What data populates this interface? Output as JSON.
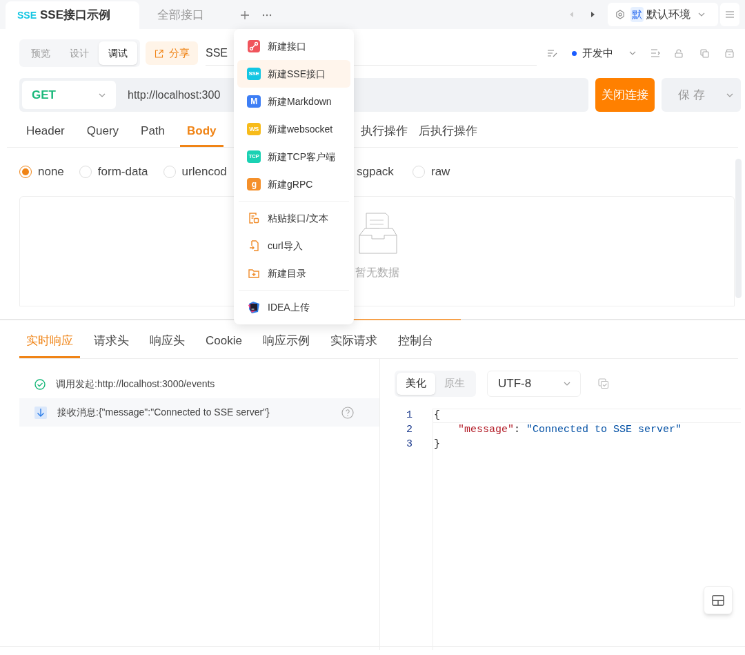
{
  "tabs": [
    {
      "badge": "SSE",
      "label": "SSE接口示例",
      "selected": true
    },
    {
      "label": "全部接口",
      "selected": false
    }
  ],
  "environment": {
    "badge": "默",
    "label": "默认环境"
  },
  "modes": [
    {
      "label": "预览",
      "selected": false
    },
    {
      "label": "设计",
      "selected": false
    },
    {
      "label": "调试",
      "selected": true
    }
  ],
  "share": "分享",
  "name": "SSE",
  "status": "开发中",
  "method": "GET",
  "url": "http://localhost:300",
  "actions": [
    "关闭连接",
    "保 存"
  ],
  "request_tabs": [
    {
      "label": "Header",
      "selected": false,
      "kind": "tab"
    },
    {
      "label": "Query",
      "selected": false,
      "kind": "tab"
    },
    {
      "label": "Path",
      "selected": false,
      "kind": "tab"
    },
    {
      "label": "Body",
      "selected": true,
      "kind": "tab"
    },
    {
      "label": "执行操作",
      "selected": false,
      "kind": "partial"
    },
    {
      "label": "后执行操作",
      "selected": false,
      "kind": "tab"
    }
  ],
  "body_types": [
    {
      "label": "none",
      "selected": true,
      "kind": "radio"
    },
    {
      "label": "form-data",
      "selected": false,
      "kind": "radio"
    },
    {
      "label": "urlencod",
      "selected": false,
      "kind": "radio"
    },
    {
      "label": "sgpack",
      "kind": "partial"
    },
    {
      "label": "raw",
      "selected": false,
      "kind": "radio"
    }
  ],
  "empty_text": "暂无数据",
  "response_tabs": [
    {
      "label": "实时响应",
      "selected": true
    },
    {
      "label": "请求头",
      "selected": false
    },
    {
      "label": "响应头",
      "selected": false
    },
    {
      "label": "Cookie",
      "selected": false
    },
    {
      "label": "响应示例",
      "selected": false
    },
    {
      "label": "实际请求",
      "selected": false
    },
    {
      "label": "控制台",
      "selected": false
    }
  ],
  "log": [
    {
      "kind": "sent",
      "text": "调用发起:http://localhost:3000/events",
      "selected": false
    },
    {
      "kind": "received",
      "text": "接收消息:{\"message\":\"Connected to SSE server\"}",
      "selected": true
    }
  ],
  "view_modes": [
    {
      "label": "美化",
      "selected": true
    },
    {
      "label": "原生",
      "selected": false
    }
  ],
  "encoding": "UTF-8",
  "code": [
    {
      "number": "1",
      "tokens": [
        {
          "kind": "punct",
          "text": "{"
        }
      ]
    },
    {
      "number": "2",
      "tokens": [
        {
          "kind": "key",
          "text": "\"message\""
        },
        {
          "kind": "punct",
          "text": ": "
        },
        {
          "kind": "string",
          "text": "\"Connected to SSE server\""
        }
      ]
    },
    {
      "number": "3",
      "tokens": [
        {
          "kind": "punct",
          "text": "}"
        }
      ]
    }
  ],
  "menu": {
    "sections": [
      [
        {
          "kind": "link",
          "label": "新建接口",
          "selected": false,
          "color": "#f0545c"
        },
        {
          "kind": "badge",
          "badge": "SSE",
          "label": "新建SSE接口",
          "selected": true,
          "color": "#13c6e3"
        },
        {
          "kind": "badge",
          "badge": "M",
          "label": "新建Markdown",
          "selected": false,
          "color": "#3d7ef5"
        },
        {
          "kind": "badge",
          "badge": "WS",
          "label": "新建websocket",
          "selected": false,
          "color": "#f7bb1a"
        },
        {
          "kind": "badge",
          "badge": "TCP",
          "label": "新建TCP客户端",
          "selected": false,
          "color": "#1ad1b3"
        },
        {
          "kind": "badge",
          "badge": "g",
          "label": "新建gRPC",
          "selected": false,
          "color": "#f5902a"
        }
      ],
      [
        {
          "kind": "paste",
          "label": "粘贴接口/文本",
          "selected": false
        },
        {
          "kind": "import",
          "label": "curl导入",
          "selected": false
        },
        {
          "kind": "folder",
          "label": "新建目录",
          "selected": false
        }
      ],
      [
        {
          "kind": "ide",
          "label": "IDEA上传",
          "selected": false
        }
      ]
    ]
  }
}
